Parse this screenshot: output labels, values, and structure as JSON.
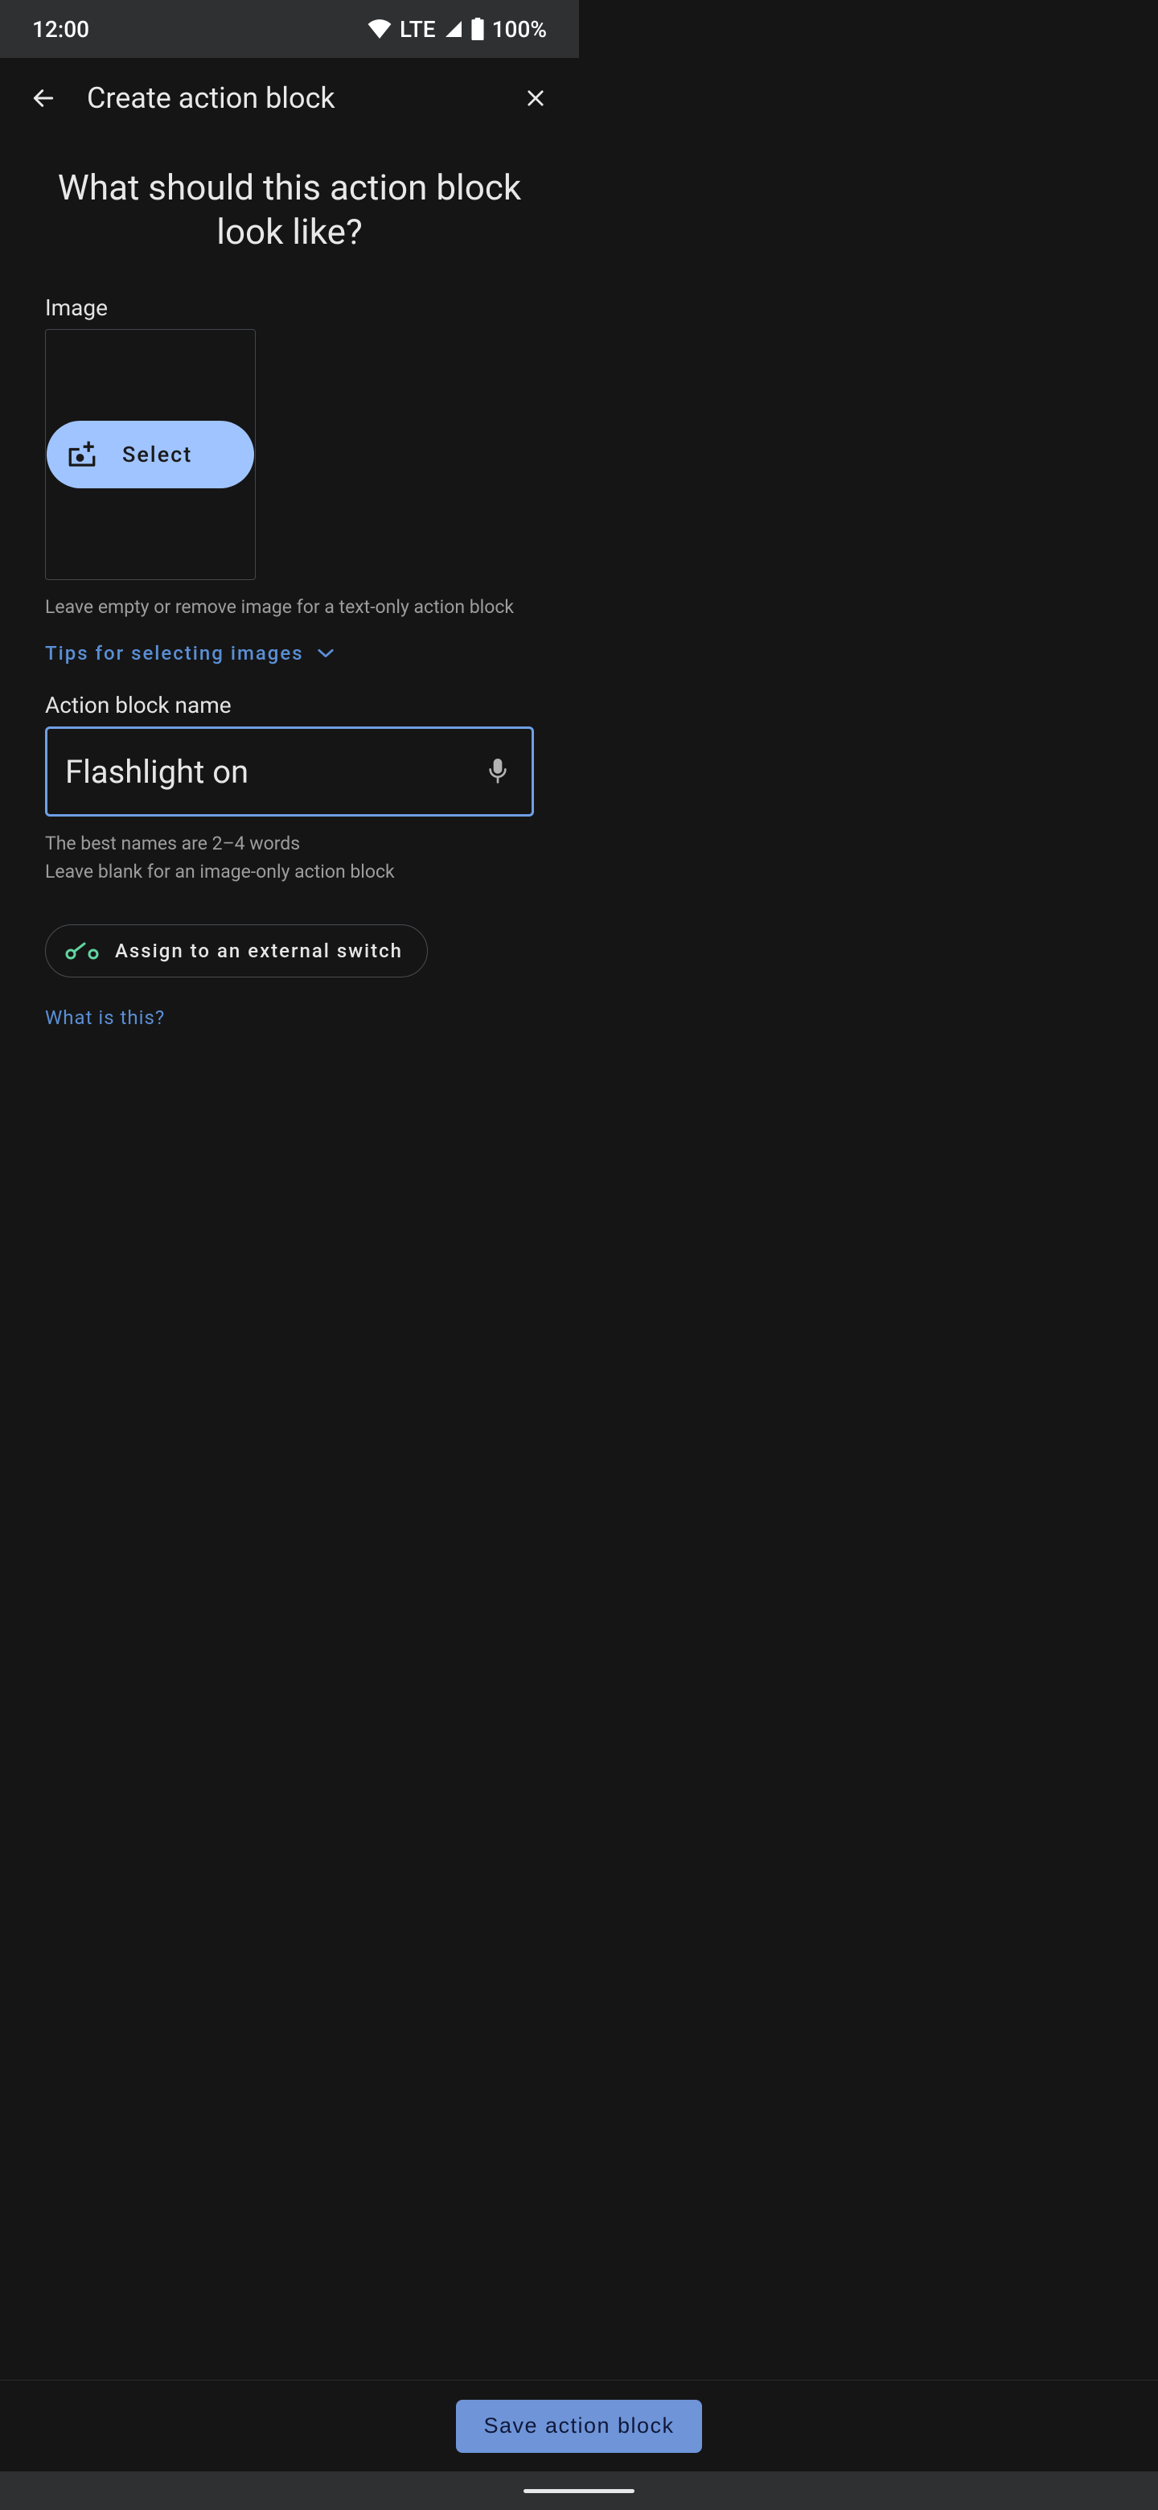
{
  "status": {
    "time": "12:00",
    "network": "LTE",
    "battery": "100%"
  },
  "appbar": {
    "title": "Create action block"
  },
  "heading": "What should this action block look like?",
  "imageSection": {
    "label": "Image",
    "selectLabel": "Select",
    "helper": "Leave empty or remove image for a text-only action block",
    "tipsLink": "Tips for selecting images"
  },
  "nameSection": {
    "label": "Action block name",
    "value": "Flashlight on",
    "helper1": "The best names are 2–4 words",
    "helper2": "Leave blank for an image-only action block"
  },
  "assign": {
    "label": "Assign to an external switch"
  },
  "whatIsThis": "What is this?",
  "footer": {
    "save": "Save action block"
  }
}
